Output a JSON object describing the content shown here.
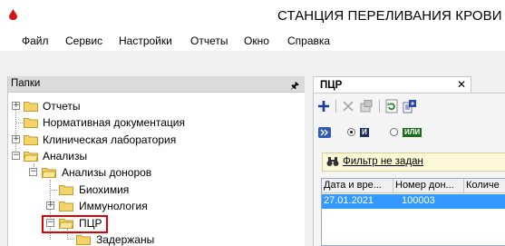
{
  "window": {
    "title": "СТАНЦИЯ ПЕРЕЛИВАНИЯ КРОВИ | С"
  },
  "menu": [
    "Файл",
    "Сервис",
    "Настройки",
    "Отчеты",
    "Окно",
    "Справка"
  ],
  "folders_panel": {
    "title": "Папки",
    "pin_icon": "pin-icon",
    "items": [
      {
        "label": "Отчеты",
        "level": 0,
        "expander": "+"
      },
      {
        "label": "Нормативная документация",
        "level": 0,
        "expander": ""
      },
      {
        "label": "Клиническая лаборатория",
        "level": 0,
        "expander": "+"
      },
      {
        "label": "Анализы",
        "level": 0,
        "expander": "−"
      },
      {
        "label": "Анализы доноров",
        "level": 1,
        "expander": "−"
      },
      {
        "label": "Биохимия",
        "level": 2,
        "expander": ""
      },
      {
        "label": "Иммунология",
        "level": 2,
        "expander": "+"
      },
      {
        "label": "ПЦР",
        "level": 2,
        "expander": "−",
        "selected": true
      },
      {
        "label": "Задержаны",
        "level": 3,
        "expander": ""
      }
    ]
  },
  "right_panel": {
    "tab_label": "ПЦР",
    "toolbar_icons": [
      "add-icon",
      "delete-icon",
      "properties-icon",
      "refresh-icon",
      "export-icon"
    ],
    "logic": {
      "toggle_icon": "double-chevron-icon",
      "and_label": "И",
      "or_label": "ИЛИ",
      "selected": "И"
    },
    "filter_label": "Фильтр не задан",
    "grid": {
      "columns": [
        "Дата и вре...",
        "Номер дон...",
        "Количе"
      ],
      "rows": [
        [
          "27.01.2021",
          "100003",
          ""
        ]
      ]
    }
  },
  "colors": {
    "selection": "#3399ff",
    "highlight_box": "#e00000",
    "and_badge": "#1f2d5a",
    "or_badge": "#1c6b1c"
  }
}
